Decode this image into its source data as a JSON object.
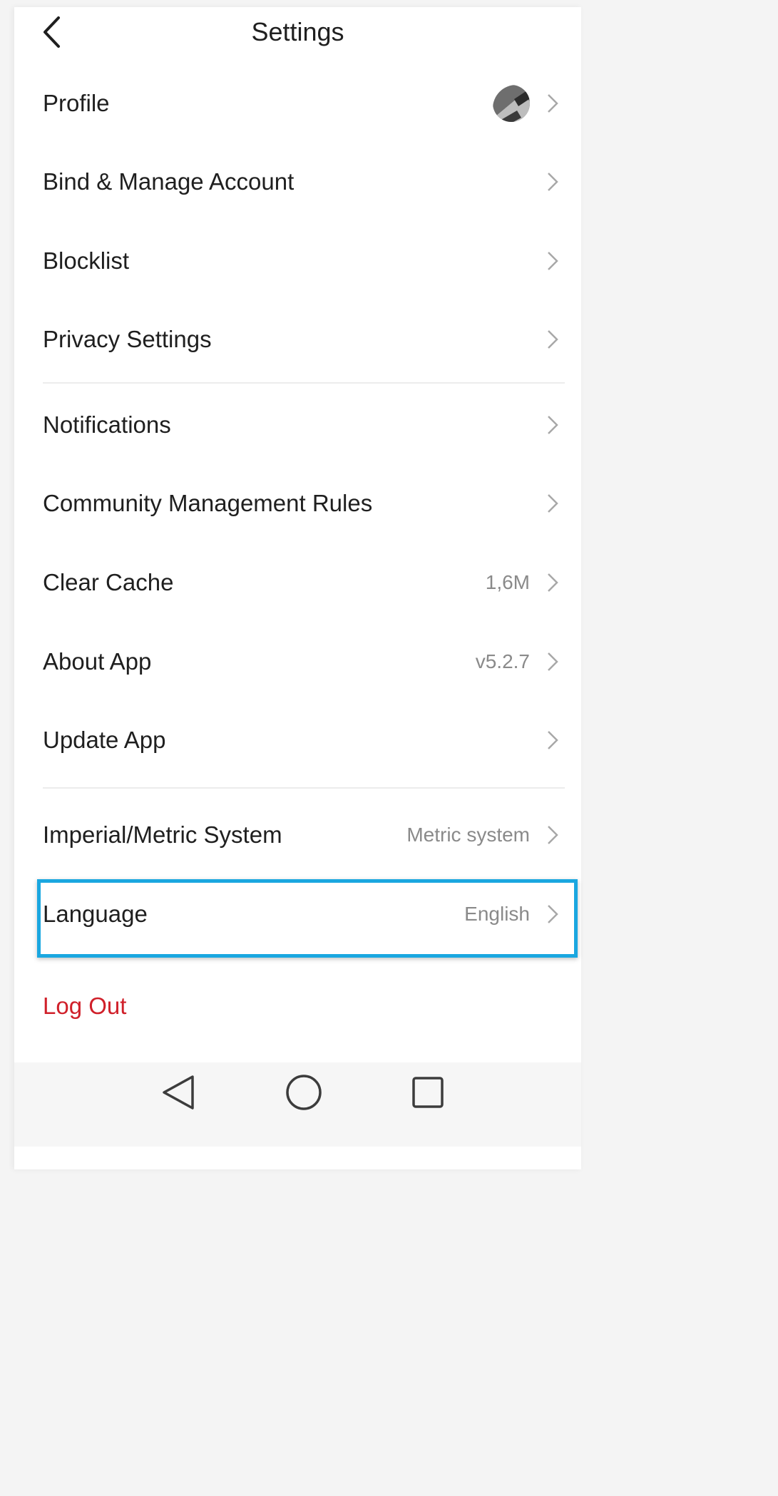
{
  "header": {
    "title": "Settings"
  },
  "items": [
    {
      "label": "Profile",
      "value": ""
    },
    {
      "label": "Bind & Manage Account",
      "value": ""
    },
    {
      "label": "Blocklist",
      "value": ""
    },
    {
      "label": "Privacy Settings",
      "value": ""
    },
    {
      "label": "Notifications",
      "value": ""
    },
    {
      "label": "Community Management Rules",
      "value": ""
    },
    {
      "label": "Clear Cache",
      "value": "1,6M"
    },
    {
      "label": "About App",
      "value": "v5.2.7"
    },
    {
      "label": "Update App",
      "value": ""
    },
    {
      "label": "Imperial/Metric System",
      "value": "Metric system"
    },
    {
      "label": "Language",
      "value": "English"
    }
  ],
  "logout_label": "Log Out",
  "icons": {
    "back": "chevron-left-icon",
    "chevron": "chevron-right-icon",
    "nav_back": "triangle-back-icon",
    "nav_home": "circle-home-icon",
    "nav_recent": "square-recent-icon"
  },
  "colors": {
    "logout": "#d0202a",
    "highlight": "#1aa7e0",
    "secondary_text": "#8a8a8a"
  }
}
